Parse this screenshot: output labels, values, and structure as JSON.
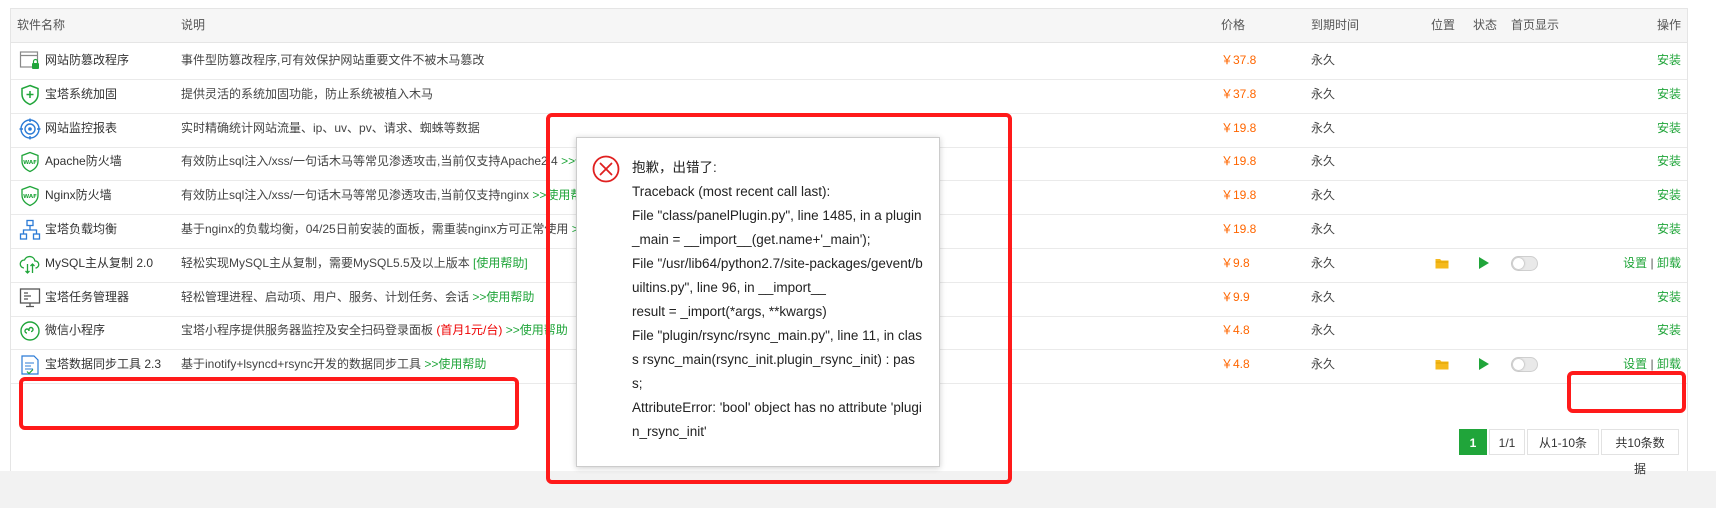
{
  "table": {
    "headers": {
      "name": "软件名称",
      "desc": "说明",
      "price": "价格",
      "expire": "到期时间",
      "position": "位置",
      "status": "状态",
      "home": "首页显示",
      "action": "操作"
    },
    "rows": [
      {
        "name": "网站防篡改程序",
        "desc": "事件型防篡改程序,可有效保护网站重要文件不被木马篡改",
        "help": "",
        "price": "￥37.8",
        "expire": "永久",
        "action_install": "安装",
        "icon": "website-tamper-icon"
      },
      {
        "name": "宝塔系统加固",
        "desc": "提供灵活的系统加固功能，防止系统被植入木马",
        "help": "",
        "price": "￥37.8",
        "expire": "永久",
        "action_install": "安装",
        "icon": "shield-plus-icon"
      },
      {
        "name": "网站监控报表",
        "desc": "实时精确统计网站流量、ip、uv、pv、请求、蜘蛛等数据",
        "help": "",
        "price": "￥19.8",
        "expire": "永久",
        "action_install": "安装",
        "icon": "monitor-target-icon"
      },
      {
        "name": "Apache防火墙",
        "desc": "有效防止sql注入/xss/一句话木马等常见渗透攻击,当前仅支持Apache2.4",
        "help": ">>使用帮助",
        "price": "￥19.8",
        "expire": "永久",
        "action_install": "安装",
        "icon": "waf-shield-icon"
      },
      {
        "name": "Nginx防火墙",
        "desc": "有效防止sql注入/xss/一句话木马等常见渗透攻击,当前仅支持nginx",
        "help": ">>使用帮助",
        "price": "￥19.8",
        "expire": "永久",
        "action_install": "安装",
        "icon": "waf-shield-icon"
      },
      {
        "name": "宝塔负载均衡",
        "desc": "基于nginx的负载均衡，04/25日前安装的面板，需重装nginx方可正常使用",
        "help": ">>使用帮助",
        "price": "￥19.8",
        "expire": "永久",
        "action_install": "安装",
        "icon": "load-balance-icon"
      },
      {
        "name": "MySQL主从复制 2.0",
        "desc": "轻松实现MySQL主从复制，需要MySQL5.5及以上版本",
        "help": "[使用帮助]",
        "price": "￥9.8",
        "expire": "永久",
        "action_settings": "设置",
        "action_uninstall": "卸载",
        "installed": true,
        "icon": "cloud-sync-icon"
      },
      {
        "name": "宝塔任务管理器",
        "desc": "轻松管理进程、启动项、用户、服务、计划任务、会话",
        "help": ">>使用帮助",
        "price": "￥9.9",
        "expire": "永久",
        "action_install": "安装",
        "icon": "task-manager-icon"
      },
      {
        "name": "微信小程序",
        "desc": "宝塔小程序提供服务器监控及安全扫码登录面板",
        "highlight": "(首月1元/台)",
        "help": ">>使用帮助",
        "price": "￥4.8",
        "expire": "永久",
        "action_install": "安装",
        "icon": "wechat-miniapp-icon"
      },
      {
        "name": "宝塔数据同步工具 2.3",
        "desc": "基于inotify+lsyncd+rsync开发的数据同步工具",
        "help": ">>使用帮助",
        "price": "￥4.8",
        "expire": "永久",
        "action_settings": "设置",
        "action_uninstall": "卸载",
        "installed": true,
        "icon": "data-sync-icon"
      }
    ],
    "separator": "|"
  },
  "pagination": {
    "current": "1",
    "pages": "1/1",
    "range": "从1-10条",
    "total": "共10条数据"
  },
  "error_dialog": {
    "title": "抱歉，出错了:",
    "lines": [
      "Traceback (most recent call last):",
      "File \"class/panelPlugin.py\", line 1485, in a plugin_main = __import__(get.name+'_main');",
      "File \"/usr/lib64/python2.7/site-packages/gevent/builtins.py\", line 96, in __import__",
      "result = _import(*args, **kwargs)",
      "File \"plugin/rsync/rsync_main.py\", line 11, in class rsync_main(rsync_init.plugin_rsync_init) : pass;",
      "AttributeError: 'bool' object has no attribute 'plugin_rsync_init'"
    ]
  },
  "colors": {
    "accent": "#20a53a",
    "price": "#ff6600",
    "annotation": "#ff1a1a",
    "error": "#e02020"
  }
}
